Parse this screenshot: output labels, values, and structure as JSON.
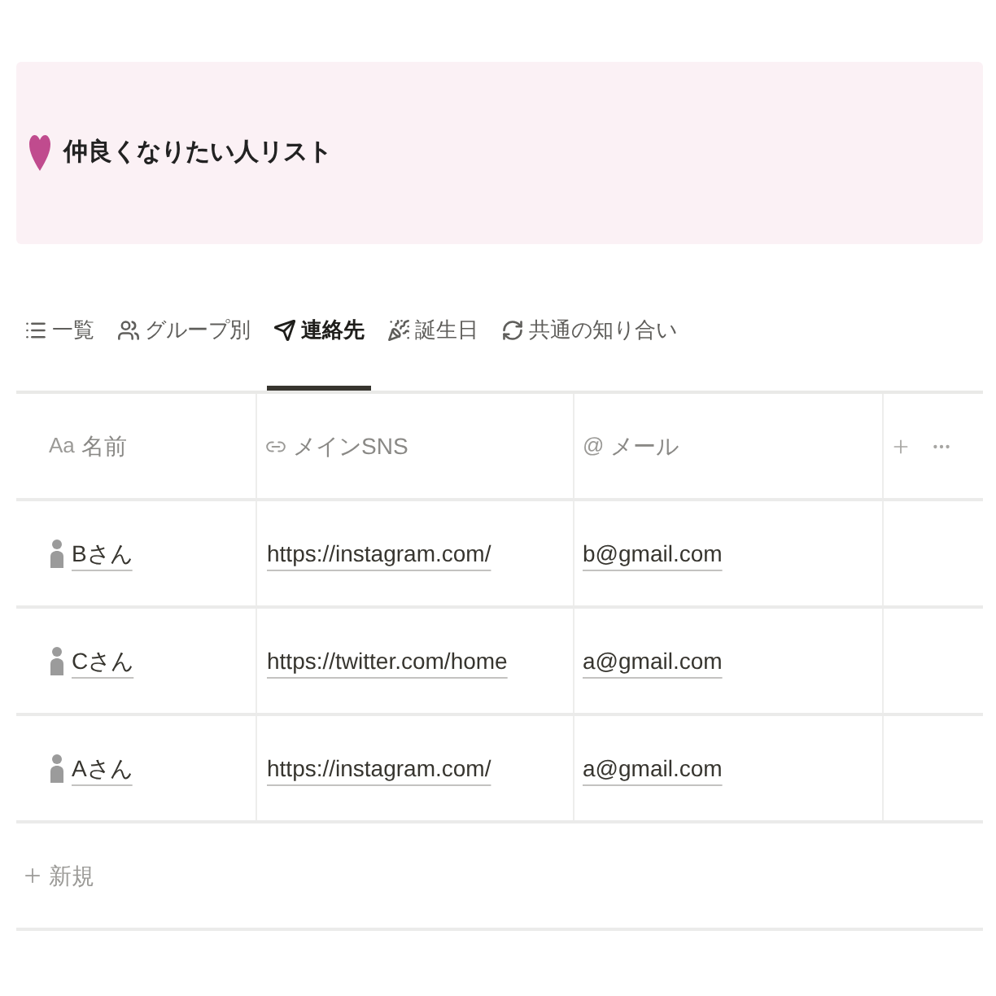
{
  "header": {
    "title": "仲良くなりたい人リスト"
  },
  "tabs": [
    {
      "label": "一覧",
      "selected": false
    },
    {
      "label": "グループ別",
      "selected": false
    },
    {
      "label": "連絡先",
      "selected": true
    },
    {
      "label": "誕生日",
      "selected": false
    },
    {
      "label": "共通の知り合い",
      "selected": false
    }
  ],
  "table": {
    "columns": [
      {
        "kind": "title",
        "mark": "Aa",
        "label": "名前"
      },
      {
        "kind": "url",
        "label": "メインSNS"
      },
      {
        "kind": "email",
        "mark": "@",
        "label": "メール"
      }
    ],
    "rows": [
      {
        "name": "Bさん",
        "sns": "https://instagram.com/",
        "email": "b@gmail.com"
      },
      {
        "name": "Cさん",
        "sns": "https://twitter.com/home",
        "email": "a@gmail.com"
      },
      {
        "name": "Aさん",
        "sns": "https://instagram.com/",
        "email": "a@gmail.com"
      }
    ]
  },
  "add_row": {
    "label": "新規"
  }
}
